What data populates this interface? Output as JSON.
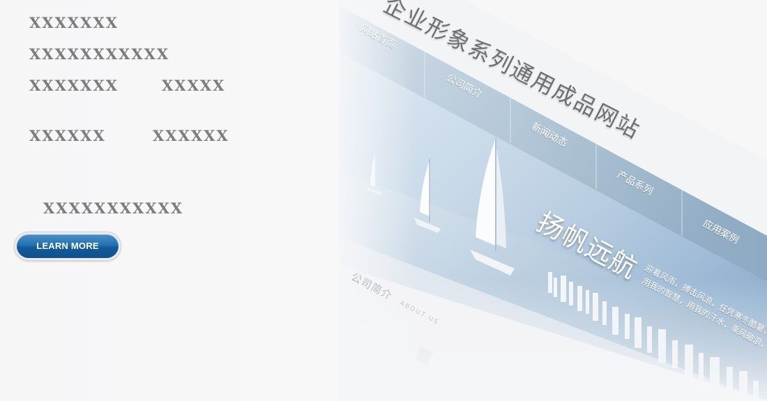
{
  "left_panel": {
    "line1": "XXXXXXX",
    "line2": "XXXXXXXXXXX",
    "line3a": "XXXXXXX",
    "line3b": "XXXXX",
    "line4a": "XXXXXX",
    "line4b": "XXXXXX",
    "line5": "XXXXXXXXXXX",
    "button_label": "LEARN MORE"
  },
  "mockup": {
    "site_title": "企业形象系列通用成品网站",
    "nav": [
      "网站首页",
      "公司简介",
      "新闻动态",
      "产品系列",
      "应用案例"
    ],
    "hero_title": "扬帆远航",
    "hero_desc_line1": "迎着风雨，搏击风浪，任凭寒冬酷暑，",
    "hero_desc_line2": "用我的智慧，用我的汗水，乘风破浪，",
    "section_title": "公司简介",
    "section_subtitle": "ABOUT US"
  },
  "colors": {
    "button_blue": "#1c67a8",
    "placeholder_text": "#7c7c7c",
    "page_background": "#f7f7f8",
    "nav_bar": "#9fb6c9",
    "banner_sky": "#b7cce0"
  }
}
